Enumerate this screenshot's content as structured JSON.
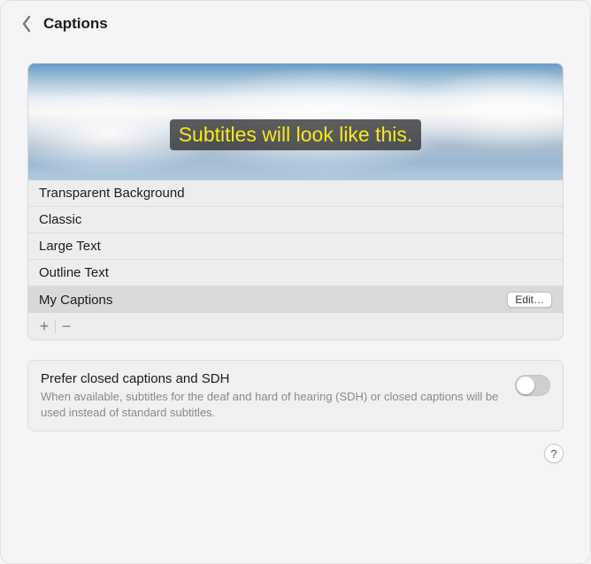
{
  "header": {
    "title": "Captions"
  },
  "preview": {
    "subtitle_text": "Subtitles will look like this."
  },
  "styles": [
    {
      "label": "Transparent Background",
      "selected": false,
      "editable": false
    },
    {
      "label": "Classic",
      "selected": false,
      "editable": false
    },
    {
      "label": "Large Text",
      "selected": false,
      "editable": false
    },
    {
      "label": "Outline Text",
      "selected": false,
      "editable": false
    },
    {
      "label": "My Captions",
      "selected": true,
      "editable": true
    }
  ],
  "edit_button_label": "Edit…",
  "controls": {
    "add": "+",
    "remove": "−"
  },
  "prefer": {
    "title": "Prefer closed captions and SDH",
    "description": "When available, subtitles for the deaf and hard of hearing (SDH) or closed captions will be used instead of standard subtitles.",
    "enabled": false
  },
  "help_label": "?"
}
